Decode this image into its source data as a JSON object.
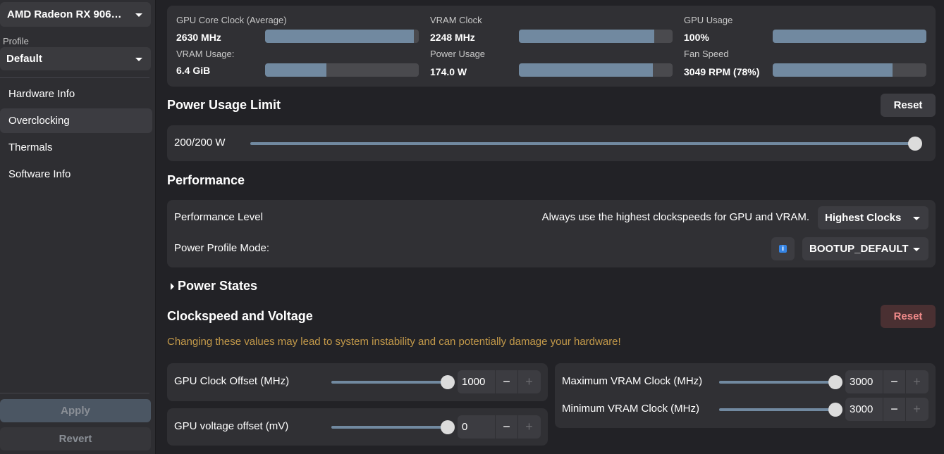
{
  "sidebar": {
    "gpu_name": "AMD Radeon RX 906…",
    "profile_label": "Profile",
    "profile_value": "Default",
    "nav": [
      "Hardware Info",
      "Overclocking",
      "Thermals",
      "Software Info"
    ],
    "active_nav": "Overclocking",
    "apply_label": "Apply",
    "revert_label": "Revert"
  },
  "stats": {
    "gpu_core_clock": {
      "label": "GPU Core Clock (Average)",
      "value": "2630 MHz",
      "fill": 0.97
    },
    "vram_clock": {
      "label": "VRAM Clock",
      "value": "2248 MHz",
      "fill": 0.88
    },
    "gpu_usage": {
      "label": "GPU Usage",
      "value": "100%",
      "fill": 1.0
    },
    "vram_usage": {
      "label": "VRAM Usage:",
      "value": "6.4 GiB",
      "fill": 0.4
    },
    "power_usage": {
      "label": "Power Usage",
      "value": "174.0 W",
      "fill": 0.87
    },
    "fan_speed": {
      "label": "Fan Speed",
      "value": "3049 RPM (78%)",
      "fill": 0.78
    }
  },
  "power_limit": {
    "title": "Power Usage Limit",
    "reset_label": "Reset",
    "value_text": "200/200 W",
    "level": 1.0
  },
  "performance": {
    "title": "Performance",
    "level_label": "Performance Level",
    "level_description": "Always use the highest clockspeeds for GPU and VRAM.",
    "level_value": "Highest Clocks",
    "profile_mode_label": "Power Profile Mode:",
    "profile_mode_value": "BOOTUP_DEFAULT",
    "info_icon": "i"
  },
  "power_states": {
    "title": "Power States"
  },
  "clockspeed": {
    "title": "Clockspeed and Voltage",
    "reset_label": "Reset",
    "warning": "Changing these values may lead to system instability and can potentially damage your hardware!",
    "gpu_clock_offset": {
      "label": "GPU Clock Offset (MHz)",
      "value": "1000",
      "level": 1.0
    },
    "gpu_voltage_offset": {
      "label": "GPU voltage offset (mV)",
      "value": "0",
      "level": 1.0
    },
    "max_vram_clock": {
      "label": "Maximum VRAM Clock (MHz)",
      "value": "3000",
      "level": 1.0
    },
    "min_vram_clock": {
      "label": "Minimum VRAM Clock (MHz)",
      "value": "3000",
      "level": 1.0
    },
    "minus": "−",
    "plus": "+"
  },
  "colors": {
    "accent": "#7189a0",
    "warning": "#c49a4a",
    "danger_text": "#f08a8a"
  }
}
